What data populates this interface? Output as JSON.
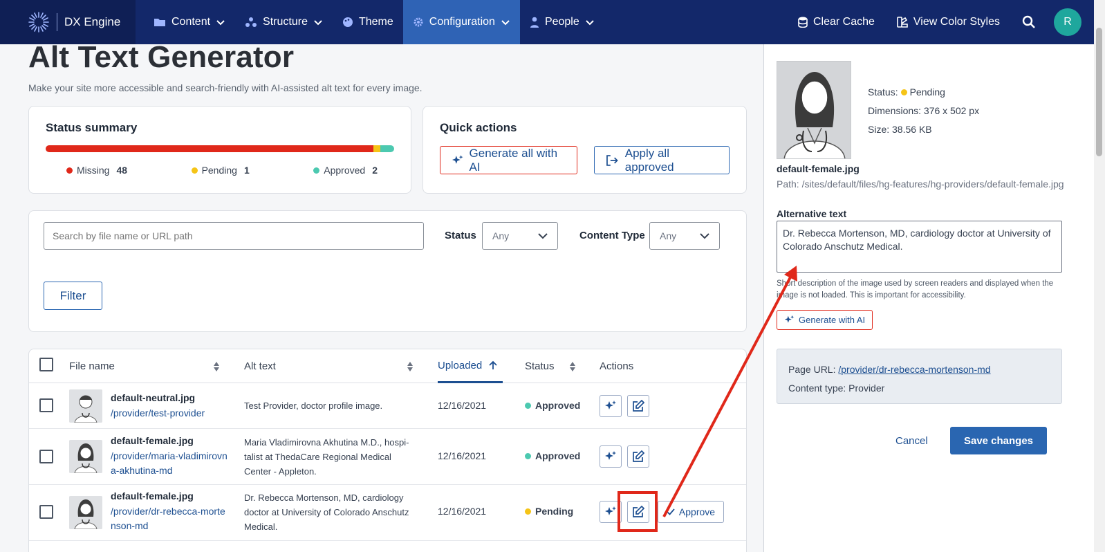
{
  "nav": {
    "brand": "DX Engine",
    "items": [
      {
        "label": "Content",
        "icon": "folder-icon"
      },
      {
        "label": "Structure",
        "icon": "structure-icon"
      },
      {
        "label": "Theme",
        "icon": "palette-icon"
      },
      {
        "label": "Configuration",
        "icon": "gear-icon"
      },
      {
        "label": "People",
        "icon": "person-icon"
      }
    ],
    "clear_cache": "Clear Cache",
    "view_color_styles": "View Color Styles",
    "avatar_initial": "R"
  },
  "page": {
    "title": "Alt Text Generator",
    "subtitle": "Make your site more accessible and search-friendly with AI-assisted alt text for every image."
  },
  "summary": {
    "title": "Status summary",
    "missing_label": "Missing",
    "missing_count": "48",
    "pending_label": "Pending",
    "pending_count": "1",
    "approved_label": "Approved",
    "approved_count": "2",
    "colors": {
      "missing": "#e0281a",
      "pending": "#f5c417",
      "approved": "#4cc9b0"
    }
  },
  "quick_actions": {
    "title": "Quick actions",
    "generate_all": "Generate all with AI",
    "apply_all": "Apply all approved"
  },
  "filters": {
    "search_placeholder": "Search by file name or URL path",
    "status_label": "Status",
    "status_value": "Any",
    "content_type_label": "Content Type",
    "content_type_value": "Any",
    "filter_button": "Filter"
  },
  "table": {
    "headers": {
      "file_name": "File name",
      "alt_text": "Alt text",
      "uploaded": "Uploaded",
      "status": "Status",
      "actions": "Actions"
    },
    "approve_label": "Approve",
    "rows": [
      {
        "file": "default-neutral.jpg",
        "path": "/provider/test-provider",
        "alt": "Test Provider, doctor profile image.",
        "date": "12/16/2021",
        "status": "Approved"
      },
      {
        "file": "default-female.jpg",
        "path": "/provider/maria-vladimirovna-akhutina-md",
        "alt": "Maria Vladimirovna Akhutina M.D., hospi-talist at ThedaCare Regional Medical Center - Appleton.",
        "date": "12/16/2021",
        "status": "Approved"
      },
      {
        "file": "default-female.jpg",
        "path": "/provider/dr-rebecca-mortenson-md",
        "alt": "Dr. Rebecca Mortenson, MD, cardiology doctor at University of Colorado Anschutz Medical.",
        "date": "12/16/2021",
        "status": "Pending"
      }
    ]
  },
  "panel": {
    "status_label": "Status:",
    "status_value": "Pending",
    "dimensions": "Dimensions: 376 x 502 px",
    "size": "Size: 38.56 KB",
    "file_name": "default-female.jpg",
    "path": "Path: /sites/default/files/hg-features/hg-providers/default-female.jpg",
    "alt_label": "Alternative text",
    "alt_value": "Dr. Rebecca Mortenson, MD, cardiology doctor at University of Colorado Anschutz Medical.",
    "help": "Short description of the image used by screen readers and displayed when the image is not loaded. This is important for accessibility.",
    "generate_button": "Generate with AI",
    "page_url_label": "Page URL:",
    "page_url": "/provider/dr-rebecca-mortenson-md",
    "content_type": "Content type: Provider",
    "cancel": "Cancel",
    "save": "Save changes"
  }
}
